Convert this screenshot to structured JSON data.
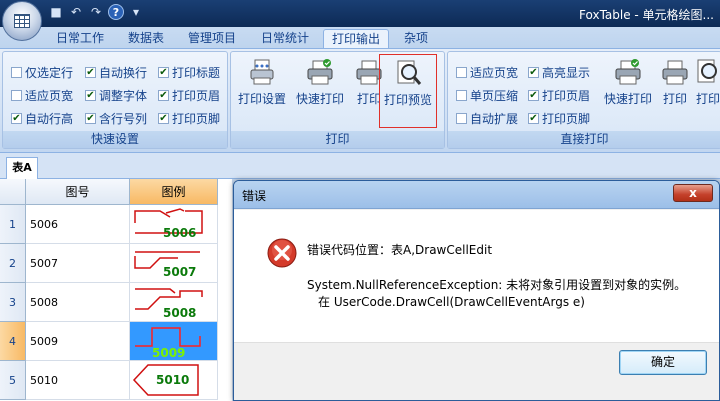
{
  "window": {
    "title": "FoxTable - 单元格绘图..."
  },
  "quick_access": [
    "save-icon",
    "undo-icon",
    "redo-icon",
    "help-icon",
    "customize-icon"
  ],
  "tabs": [
    {
      "label": "日常工作"
    },
    {
      "label": "数据表"
    },
    {
      "label": "管理项目"
    },
    {
      "label": "日常统计"
    },
    {
      "label": "打印输出",
      "active": true
    },
    {
      "label": "杂项"
    }
  ],
  "ribbon": {
    "quick_settings": {
      "label": "快速设置",
      "checkboxes": [
        {
          "label": "仅选定行",
          "checked": false
        },
        {
          "label": "自动换行",
          "checked": true
        },
        {
          "label": "打印标题",
          "checked": true
        },
        {
          "label": "适应页宽",
          "checked": false
        },
        {
          "label": "调整字体",
          "checked": true
        },
        {
          "label": "打印页眉",
          "checked": true
        },
        {
          "label": "自动行高",
          "checked": true
        },
        {
          "label": "含行号列",
          "checked": true
        },
        {
          "label": "打印页脚",
          "checked": true
        }
      ]
    },
    "print": {
      "label": "打印",
      "buttons": [
        {
          "label": "打印设置",
          "icon": "print-setup-icon"
        },
        {
          "label": "快速打印",
          "icon": "quick-print-icon"
        },
        {
          "label": "打印",
          "icon": "printer-icon"
        },
        {
          "label": "打印预览",
          "icon": "print-preview-icon",
          "selected": true
        }
      ]
    },
    "direct_print": {
      "label": "直接打印",
      "checkboxes": [
        {
          "label": "适应页宽",
          "checked": false
        },
        {
          "label": "高亮显示",
          "checked": true
        },
        {
          "label": "单页压缩",
          "checked": false
        },
        {
          "label": "打印页眉",
          "checked": true
        },
        {
          "label": "自动扩展",
          "checked": false
        },
        {
          "label": "打印页脚",
          "checked": true
        }
      ],
      "buttons": [
        {
          "label": "快速打印",
          "icon": "quick-print-icon"
        },
        {
          "label": "打印",
          "icon": "printer-icon"
        },
        {
          "label": "打印",
          "icon": "print-preview-icon"
        }
      ]
    }
  },
  "sheet": {
    "tab": "表A",
    "columns": [
      "图号",
      "图例"
    ],
    "rows": [
      {
        "num": "1",
        "no": "5006",
        "pic": "5006"
      },
      {
        "num": "2",
        "no": "5007",
        "pic": "5007"
      },
      {
        "num": "3",
        "no": "5008",
        "pic": "5008"
      },
      {
        "num": "4",
        "no": "5009",
        "pic": "5009",
        "selected": true
      },
      {
        "num": "5",
        "no": "5010",
        "pic": "5010"
      }
    ]
  },
  "dialog": {
    "title": "错误",
    "close": "x",
    "line1": "错误代码位置：表A,DrawCellEdit",
    "line2": "System.NullReferenceException: 未将对象引用设置到对象的实例。",
    "line3": "在 UserCode.DrawCell(DrawCellEventArgs e)",
    "ok": "确定"
  },
  "colors": {
    "accent": "#15428b",
    "selection": "#3399ff",
    "error": "#c4402a"
  }
}
